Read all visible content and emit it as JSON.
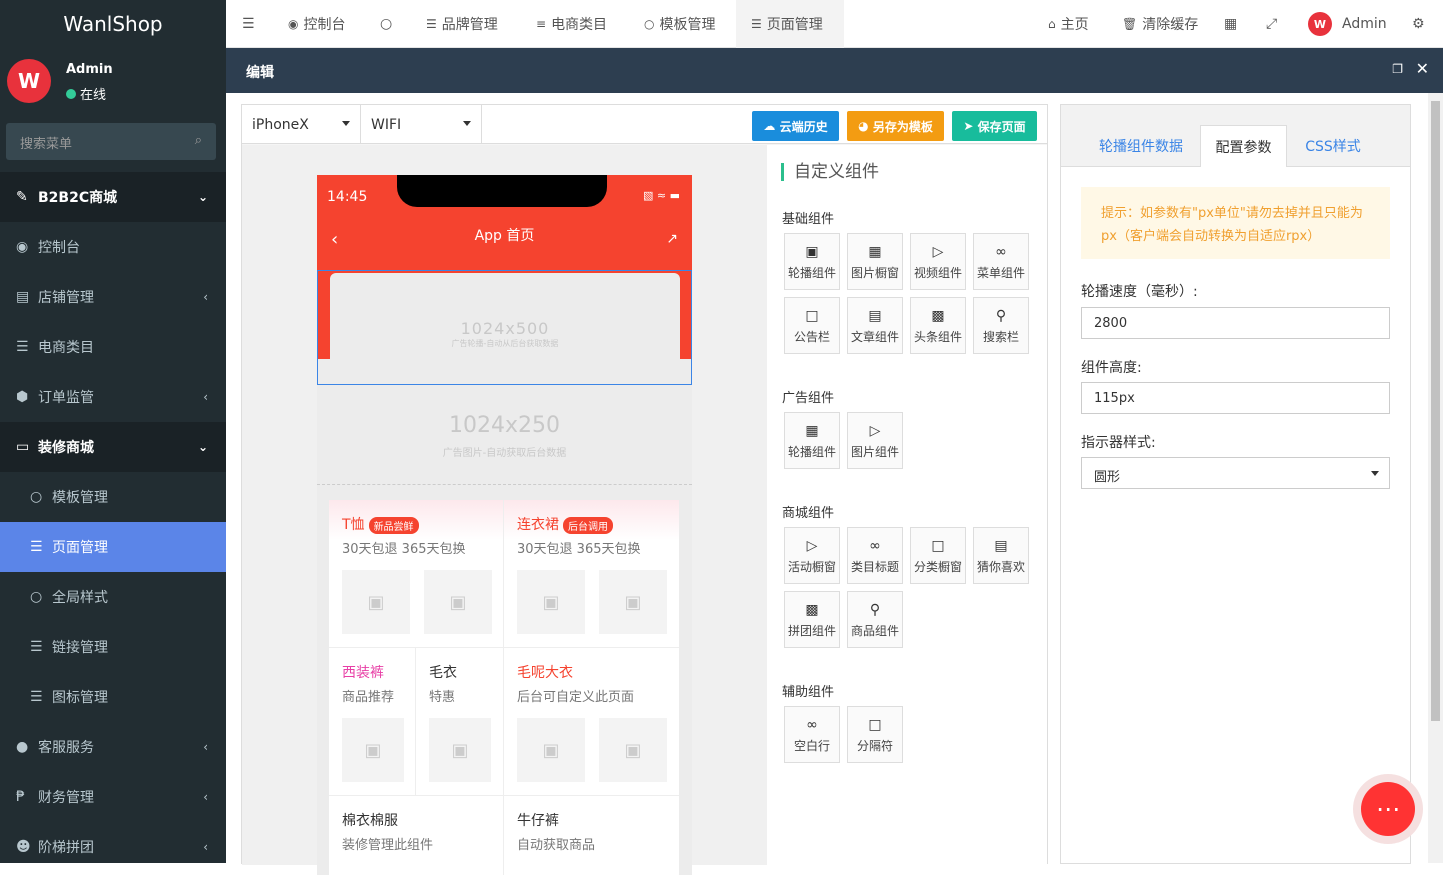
{
  "brand": "WanlShop",
  "user": {
    "avatar_text": "W",
    "name": "Admin",
    "status": "在线"
  },
  "sidebar": {
    "search_placeholder": "搜索菜单",
    "items": [
      {
        "label": "B2B2C商城",
        "icon": "wand-icon",
        "type": "head",
        "arrow": "⌄"
      },
      {
        "label": "控制台",
        "icon": "dashboard-icon",
        "type": "item",
        "arrow": ""
      },
      {
        "label": "店铺管理",
        "icon": "store-icon",
        "type": "item",
        "arrow": "‹"
      },
      {
        "label": "电商类目",
        "icon": "list-icon",
        "type": "item",
        "arrow": ""
      },
      {
        "label": "订单监管",
        "icon": "shield-icon",
        "type": "item",
        "arrow": "‹"
      },
      {
        "label": "装修商城",
        "icon": "monitor-icon",
        "type": "head",
        "arrow": "⌄"
      },
      {
        "label": "模板管理",
        "icon": "circle-icon",
        "type": "sub",
        "arrow": ""
      },
      {
        "label": "页面管理",
        "icon": "list-icon",
        "type": "sub active",
        "arrow": ""
      },
      {
        "label": "全局样式",
        "icon": "circle-icon",
        "type": "sub",
        "arrow": ""
      },
      {
        "label": "链接管理",
        "icon": "list-icon",
        "type": "sub",
        "arrow": ""
      },
      {
        "label": "图标管理",
        "icon": "list-icon",
        "type": "sub",
        "arrow": ""
      },
      {
        "label": "客服服务",
        "icon": "chat-icon",
        "type": "item",
        "arrow": "‹"
      },
      {
        "label": "财务管理",
        "icon": "money-icon",
        "type": "item",
        "arrow": "‹"
      },
      {
        "label": "阶梯拼团",
        "icon": "group-icon",
        "type": "item",
        "arrow": "‹"
      }
    ]
  },
  "topbar": {
    "tabs": [
      "控制台",
      "品牌管理",
      "电商类目",
      "模板管理",
      "页面管理"
    ],
    "right": {
      "home": "主页",
      "clear": "清除缓存",
      "admin": "Admin"
    }
  },
  "window": {
    "title": "编辑"
  },
  "editor": {
    "device": "iPhoneX",
    "network": "WIFI",
    "buttons": {
      "history": "云端历史",
      "save_tpl": "另存为模板",
      "save": "保存页面"
    },
    "phone": {
      "time": "14:45",
      "title": "App 首页",
      "banner": {
        "size": "1024x500",
        "desc": "广告轮播-自动从后台获取数据"
      },
      "ad": {
        "size": "1024x250",
        "desc": "广告图片-自动获取后台数据"
      },
      "goods": [
        {
          "title": "T恤",
          "tag": "新品尝鲜",
          "sub": "30天包退 365天包换"
        },
        {
          "title": "连衣裙",
          "tag": "后台调用",
          "sub": "30天包退 365天包换"
        },
        {
          "title": "西装裤",
          "sub": "商品推荐"
        },
        {
          "title": "毛衣",
          "sub": "特惠"
        },
        {
          "title": "毛呢大衣",
          "sub": "后台可自定义此页面"
        },
        {
          "title": "棉衣棉服",
          "sub": "装修管理此组件"
        },
        {
          "title": "牛仔裤",
          "sub": "自动获取商品"
        }
      ]
    },
    "components": {
      "title": "自定义组件",
      "sections": [
        {
          "name": "基础组件",
          "items": [
            "轮播组件",
            "图片橱窗",
            "视频组件",
            "菜单组件",
            "公告栏",
            "文章组件",
            "头条组件",
            "搜索栏"
          ]
        },
        {
          "name": "广告组件",
          "items": [
            "轮播组件",
            "图片组件"
          ]
        },
        {
          "name": "商城组件",
          "items": [
            "活动橱窗",
            "类目标题",
            "分类橱窗",
            "猜你喜欢",
            "拼团组件",
            "商品组件"
          ]
        },
        {
          "name": "辅助组件",
          "items": [
            "空白行",
            "分隔符"
          ]
        }
      ]
    }
  },
  "panel": {
    "tabs": [
      "轮播组件数据",
      "配置参数",
      "CSS样式"
    ],
    "tip": "提示：如参数有\"px单位\"请勿去掉并且只能为px（客户端会自动转换为自适应rpx）",
    "speed_label": "轮播速度（毫秒）:",
    "speed_value": "2800",
    "height_label": "组件高度:",
    "height_value": "115px",
    "indicator_label": "指示器样式:",
    "indicator_value": "圆形"
  },
  "colors": {
    "sidebar": "#222d32",
    "active": "#5b85e8",
    "header": "#2d3e50",
    "accent_red": "#f5432f"
  }
}
